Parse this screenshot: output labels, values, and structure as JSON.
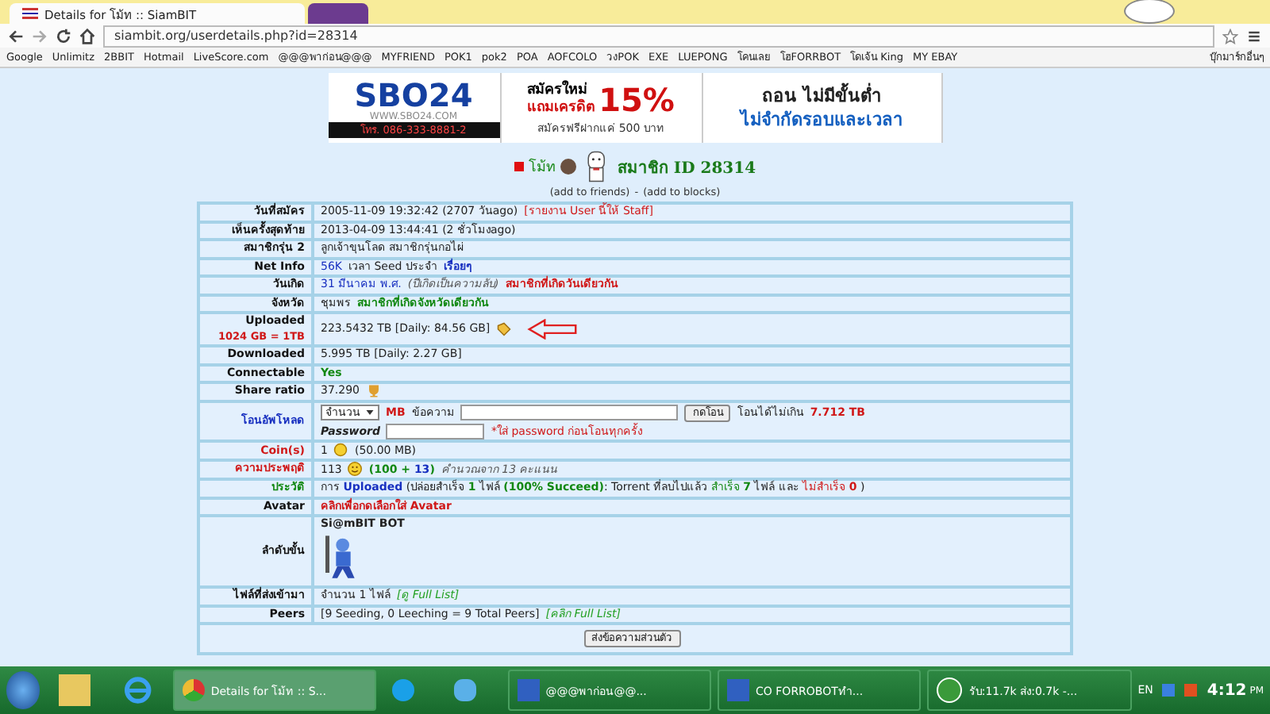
{
  "browser": {
    "tabs": [
      {
        "title": "Details for โม้ท :: SiamBIT",
        "selected": true
      },
      {
        "selected": false
      }
    ],
    "address": "siambit.org/userdetails.php?id=28314",
    "bookmarks": [
      "Google",
      "Unlimitz",
      "2BBIT",
      "Hotmail",
      "LiveScore.com",
      "@@@พาก่อน@@@",
      "MYFRIEND",
      "POK1",
      "pok2",
      "POA",
      "AOFCOLO",
      "วงPOK",
      "EXE",
      "LUEPONG",
      "โคนเลย",
      "โฮFORRBOT",
      "โดเจ้น King",
      "MY EBAY"
    ],
    "other_bookmarks": "บุ๊กมาร์กอื่นๆ"
  },
  "banner": {
    "brand": "SBO24",
    "site": "WWW.SBO24.COM",
    "phone": "โทร. 086-333-8881-2",
    "promo_lines": [
      "สมัครใหม่",
      "แถมเครดิต"
    ],
    "percent": "15%",
    "promo_sub": "สมัครฟรีฝากแค่ 500 บาท",
    "withdraw_lines": [
      "ถอน ไม่มีขั้นต่ำ",
      "ไม่จำกัดรอบและเวลา"
    ]
  },
  "profile": {
    "name": "โม้ท",
    "member_id": "สมาชิก ID 28314",
    "add_friends": "(add to friends)",
    "separator": "-",
    "add_blocks": "(add to blocks)"
  },
  "rows": [
    {
      "label": "วันที่สมัคร",
      "color": "#111111",
      "parts": [
        {
          "kind": "text",
          "color": "#222222",
          "text": "2005-11-09 19:32:42 (2707 วันago)"
        },
        {
          "kind": "link",
          "color": "#d01818",
          "text": "[รายงาน User นี้ให้ Staff]"
        }
      ]
    },
    {
      "label": "เห็นครั้งสุดท้าย",
      "color": "#111111",
      "parts": [
        {
          "kind": "text",
          "color": "#222222",
          "text": "2013-04-09 13:44:41 (2 ชั่วโมงago)"
        }
      ]
    },
    {
      "label": "สมาชิกรุ่น 2",
      "color": "#111111",
      "parts": [
        {
          "kind": "text",
          "color": "#222222",
          "text": "ลูกเจ้าขุนโลด สมาชิกรุ่นกอไผ่"
        }
      ]
    },
    {
      "label": "Net Info",
      "color": "#111111",
      "parts": [
        {
          "kind": "link",
          "color": "#1830c0",
          "text": "56K"
        },
        {
          "kind": "text",
          "color": "#222222",
          "text": "เวลา Seed ประจำ"
        },
        {
          "kind": "link",
          "color": "#1830c0",
          "bold": true,
          "text": "เรื่อยๆ"
        }
      ]
    },
    {
      "label": "วันเกิด",
      "color": "#111111",
      "parts": [
        {
          "kind": "text",
          "color": "#1830c0",
          "text": "31 มีนาคม พ.ศ."
        },
        {
          "kind": "text",
          "color": "#555555",
          "italic": true,
          "text": "(ปีเกิดเป็นความลับ)"
        },
        {
          "kind": "link",
          "color": "#d01818",
          "bold": true,
          "text": "สมาชิกที่เกิดวันเดียวกัน"
        }
      ]
    },
    {
      "label": "จังหวัด",
      "color": "#111111",
      "parts": [
        {
          "kind": "text",
          "color": "#222222",
          "text": "ชุมพร"
        },
        {
          "kind": "link",
          "color": "#118811",
          "bold": true,
          "text": "สมาชิกที่เกิดจังหวัดเดียวกัน"
        }
      ]
    },
    {
      "label": "Uploaded",
      "sublabel": "1024 GB = 1TB",
      "color": "#111111",
      "parts": [
        {
          "kind": "text",
          "color": "#222222",
          "text": "223.5432 TB [Daily: 84.56 GB]"
        },
        {
          "kind": "tag"
        },
        {
          "kind": "arrow"
        }
      ]
    },
    {
      "label": "Downloaded",
      "color": "#111111",
      "parts": [
        {
          "kind": "text",
          "color": "#222222",
          "text": "5.995 TB [Daily: 2.27 GB]"
        }
      ]
    },
    {
      "label": "Connectable",
      "color": "#111111",
      "parts": [
        {
          "kind": "text",
          "color": "#118811",
          "bold": true,
          "text": "Yes"
        }
      ]
    },
    {
      "label": "Share ratio",
      "color": "#111111",
      "parts": [
        {
          "kind": "text",
          "color": "#222222",
          "text": "37.290"
        },
        {
          "kind": "trophy"
        }
      ]
    },
    {
      "label": "โอนอัพโหลด",
      "color": "#1830c0",
      "parts": [
        {
          "kind": "select",
          "text": "จำนวน"
        },
        {
          "kind": "text",
          "color": "#d01818",
          "bold": true,
          "text": "MB"
        },
        {
          "kind": "text",
          "color": "#222222",
          "text": "ข้อความ"
        },
        {
          "kind": "input"
        },
        {
          "kind": "button",
          "text": "กดโอน"
        },
        {
          "kind": "text",
          "color": "#222222",
          "text": "โอนได้ไม่เกิน"
        },
        {
          "kind": "text",
          "color": "#d01818",
          "bold": true,
          "text": "7.712 TB"
        },
        {
          "kind": "break"
        },
        {
          "kind": "text",
          "color": "#222222",
          "bold": true,
          "italic": true,
          "text": "Password"
        },
        {
          "kind": "password"
        },
        {
          "kind": "text",
          "color": "#d01818",
          "text": "*ใส่ password ก่อนโอนทุกครั้ง"
        }
      ]
    },
    {
      "label": "Coin(s)",
      "color": "#d01818",
      "parts": [
        {
          "kind": "text",
          "color": "#222222",
          "text": "1"
        },
        {
          "kind": "coin"
        },
        {
          "kind": "text",
          "color": "#222222",
          "text": "(50.00 MB)"
        }
      ]
    },
    {
      "label": "ความประพฤติ",
      "color": "#d01818",
      "parts": [
        {
          "kind": "text",
          "color": "#222222",
          "text": "113"
        },
        {
          "kind": "smiley"
        },
        {
          "kind": "sentence",
          "segments": [
            {
              "color": "#118811",
              "bold": true,
              "text": "(100 + "
            },
            {
              "color": "#1830c0",
              "bold": true,
              "text": "13"
            },
            {
              "color": "#118811",
              "bold": true,
              "text": ")"
            }
          ]
        },
        {
          "kind": "text",
          "color": "#555555",
          "italic": true,
          "text": "คำนวณจาก 13 คะแนน"
        }
      ]
    },
    {
      "label": "ประวัติ",
      "color": "#118811",
      "parts": [
        {
          "kind": "sentence",
          "segments": [
            {
              "color": "#222222",
              "text": "การ "
            },
            {
              "color": "#1830c0",
              "bold": true,
              "text": "Uploaded"
            },
            {
              "color": "#222222",
              "text": " (ปล่อยสำเร็จ "
            },
            {
              "color": "#118811",
              "bold": true,
              "text": "1"
            },
            {
              "color": "#222222",
              "text": " ไฟล์ "
            },
            {
              "color": "#118811",
              "bold": true,
              "text": "(100% Succeed)"
            },
            {
              "color": "#222222",
              "text": ": Torrent ที่ลบไปแล้ว "
            },
            {
              "color": "#118811",
              "text": "สำเร็จ "
            },
            {
              "color": "#118811",
              "bold": true,
              "text": "7"
            },
            {
              "color": "#222222",
              "text": " ไฟล์ และ "
            },
            {
              "color": "#d01818",
              "text": "ไม่สำเร็จ "
            },
            {
              "color": "#d01818",
              "bold": true,
              "text": "0"
            },
            {
              "text": " )"
            }
          ]
        }
      ]
    },
    {
      "label": "Avatar",
      "color": "#111111",
      "parts": [
        {
          "kind": "link",
          "color": "#d01818",
          "bold": true,
          "text": "คลิกเพื่อกดเลือกใส่ Avatar"
        }
      ]
    },
    {
      "label": "ลำดับขั้น",
      "color": "#111111",
      "parts": [
        {
          "kind": "text",
          "color": "#222222",
          "bold": true,
          "text": "Si@mBIT BOT"
        },
        {
          "kind": "break"
        },
        {
          "kind": "figure"
        }
      ]
    },
    {
      "label": "ไฟล์ที่ส่งเข้ามา",
      "color": "#111111",
      "parts": [
        {
          "kind": "text",
          "color": "#222222",
          "text": "จำนวน 1 ไฟล์"
        },
        {
          "kind": "link",
          "color": "#22a022",
          "italic": true,
          "text": "[ดู Full List]"
        }
      ]
    },
    {
      "label": "Peers",
      "color": "#111111",
      "parts": [
        {
          "kind": "text",
          "color": "#222222",
          "text": "[9 Seeding, 0 Leeching = 9 Total Peers]"
        },
        {
          "kind": "link",
          "color": "#22a022",
          "italic": true,
          "text": "[คลิก Full List]"
        }
      ]
    }
  ],
  "message_button": "ส่งข้อความส่วนตัว",
  "taskbar": {
    "windows": [
      {
        "kind": "chrome",
        "title": "Details for โม้ท :: S...",
        "selected": true
      },
      {
        "kind": "skype",
        "selected": false
      },
      {
        "kind": "messenger",
        "selected": false
      },
      {
        "kind": "computer",
        "title": "@@@พาก่อน@@...",
        "selected": false
      },
      {
        "kind": "computer",
        "title": "CO FORROBOTทำ...",
        "selected": false
      },
      {
        "kind": "torrent",
        "title": "รับ:11.7k ส่ง:0.7k -...",
        "selected": false
      }
    ],
    "language": "EN",
    "time": "4:12",
    "ampm": "PM"
  }
}
